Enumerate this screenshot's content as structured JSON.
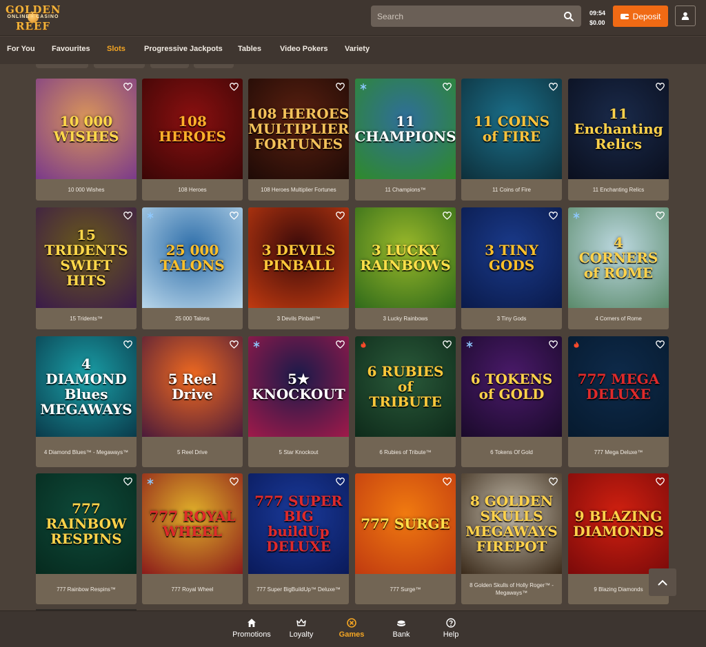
{
  "logo": {
    "line1": "GOLDEN",
    "line2": "ONLINE · CASINO",
    "line3": "REEF"
  },
  "search": {
    "placeholder": "Search"
  },
  "clock": {
    "time": "09:54",
    "balance": "$0.00"
  },
  "deposit": {
    "label": "Deposit"
  },
  "categories": [
    "For You",
    "Favourites",
    "Slots",
    "Progressive Jackpots",
    "Tables",
    "Video Pokers",
    "Variety"
  ],
  "active_category": "Slots",
  "games": [
    {
      "name": "10 000 Wishes",
      "art": "10 000 WISHES",
      "bg": "#d9955a",
      "bg2": "#7a3a8a",
      "color": "#ffd84a",
      "badge": ""
    },
    {
      "name": "108 Heroes",
      "art": "108 HEROES",
      "bg": "#8a1010",
      "bg2": "#3a0606",
      "color": "#ffb02a",
      "badge": ""
    },
    {
      "name": "108 Heroes Multiplier Fortunes",
      "art": "108 HEROES MULTIPLIER FORTUNES",
      "bg": "#5a2010",
      "bg2": "#1e0a06",
      "color": "#f3c25a",
      "badge": ""
    },
    {
      "name": "11 Champions™",
      "art": "11 CHAMPIONS",
      "bg": "#2f6e9a",
      "bg2": "#2f8a2a",
      "color": "#ffffff",
      "badge": "snow"
    },
    {
      "name": "11 Coins of Fire",
      "art": "11 COINS of FIRE",
      "bg": "#1b6f8a",
      "bg2": "#0d2f3a",
      "color": "#ffc23a",
      "badge": ""
    },
    {
      "name": "11 Enchanting Relics",
      "art": "11 Enchanting Relics",
      "bg": "#1a2a4a",
      "bg2": "#0a0f1e",
      "color": "#ffd24a",
      "badge": ""
    },
    {
      "name": "15 Tridents™",
      "art": "15 TRIDENTS SWIFT HITS",
      "bg": "#6a5a1a",
      "bg2": "#3a1a4a",
      "color": "#ffd84a",
      "badge": ""
    },
    {
      "name": "25 000 Talons",
      "art": "25 000 TALONS",
      "bg": "#2f6faa",
      "bg2": "#b9d6ea",
      "color": "#ffc02a",
      "badge": "snow"
    },
    {
      "name": "3 Devils Pinball™",
      "art": "3 DEVILS PINBALL",
      "bg": "#3a0a0a",
      "bg2": "#c03a10",
      "color": "#ffc83a",
      "badge": ""
    },
    {
      "name": "3 Lucky Rainbows",
      "art": "3 LUCKY RAINBOWS",
      "bg": "#9ab82a",
      "bg2": "#2f6a1a",
      "color": "#ffe04a",
      "badge": ""
    },
    {
      "name": "3 Tiny Gods",
      "art": "3 TINY GODS",
      "bg": "#1a3a8a",
      "bg2": "#0a1a4a",
      "color": "#ffc02a",
      "badge": ""
    },
    {
      "name": "4 Corners of Rome",
      "art": "4 CORNERS of ROME",
      "bg": "#bcd8e0",
      "bg2": "#5a8a6a",
      "color": "#ffd24a",
      "badge": "snow"
    },
    {
      "name": "4 Diamond Blues™ - Megaways™",
      "art": "4 DIAMOND Blues MEGAWAYS",
      "bg": "#1aa0a8",
      "bg2": "#0a3a4a",
      "color": "#ffffff",
      "badge": ""
    },
    {
      "name": "5 Reel Drive",
      "art": "5 Reel Drive",
      "bg": "#f06a20",
      "bg2": "#4a1a3a",
      "color": "#ffffff",
      "badge": ""
    },
    {
      "name": "5 Star Knockout",
      "art": "5★ KNOCKOUT",
      "bg": "#1a1a4a",
      "bg2": "#a01a4a",
      "color": "#ffffff",
      "badge": "snow"
    },
    {
      "name": "6 Rubies of Tribute™",
      "art": "6 RUBIES of TRIBUTE",
      "bg": "#2a5a3a",
      "bg2": "#0e2a1a",
      "color": "#ffc83a",
      "badge": "fire"
    },
    {
      "name": "6 Tokens Of Gold",
      "art": "6 TOKENS of GOLD",
      "bg": "#4a1a6a",
      "bg2": "#1a0a2a",
      "color": "#ffd24a",
      "badge": "snow"
    },
    {
      "name": "777 Mega Deluxe™",
      "art": "777 MEGA DELUXE",
      "bg": "#0e2a4a",
      "bg2": "#061a2e",
      "color": "#e02a2a",
      "badge": "fire"
    },
    {
      "name": "777 Rainbow Respins™",
      "art": "777 RAINBOW RESPINS",
      "bg": "#0e4a3a",
      "bg2": "#062a1e",
      "color": "#ffd24a",
      "badge": ""
    },
    {
      "name": "777 Royal Wheel",
      "art": "777 ROYAL WHEEL",
      "bg": "#e0b02a",
      "bg2": "#8a1a1a",
      "color": "#e02a2a",
      "badge": "snow"
    },
    {
      "name": "777 Super BigBuildUp™ Deluxe™",
      "art": "777 SUPER BIG buildUp DELUXE",
      "bg": "#1a3a9a",
      "bg2": "#0a1a5a",
      "color": "#e02a2a",
      "badge": ""
    },
    {
      "name": "777 Surge™",
      "art": "777 SURGE",
      "bg": "#f07a10",
      "bg2": "#c03a10",
      "color": "#ffe04a",
      "badge": ""
    },
    {
      "name": "8 Golden Skulls of Holly Roger™ - Megaways™",
      "art": "8 GOLDEN SKULLS MEGAWAYS FIREPOT",
      "bg": "#c0b8a8",
      "bg2": "#3a2a1a",
      "color": "#ffd24a",
      "badge": ""
    },
    {
      "name": "9 Blazing Diamonds",
      "art": "9 BLAZING DIAMONDS",
      "bg": "#d02010",
      "bg2": "#7a0a0a",
      "color": "#ffd24a",
      "badge": ""
    }
  ],
  "bottom_nav": [
    {
      "label": "Promotions",
      "icon": "home-icon"
    },
    {
      "label": "Loyalty",
      "icon": "crown-icon"
    },
    {
      "label": "Games",
      "icon": "games-icon"
    },
    {
      "label": "Bank",
      "icon": "bank-icon"
    },
    {
      "label": "Help",
      "icon": "help-icon"
    }
  ],
  "active_bottom": "Games",
  "colors": {
    "accent": "#f5a623",
    "deposit": "#f06a14",
    "background": "#4b4139",
    "header": "#3f3630"
  }
}
